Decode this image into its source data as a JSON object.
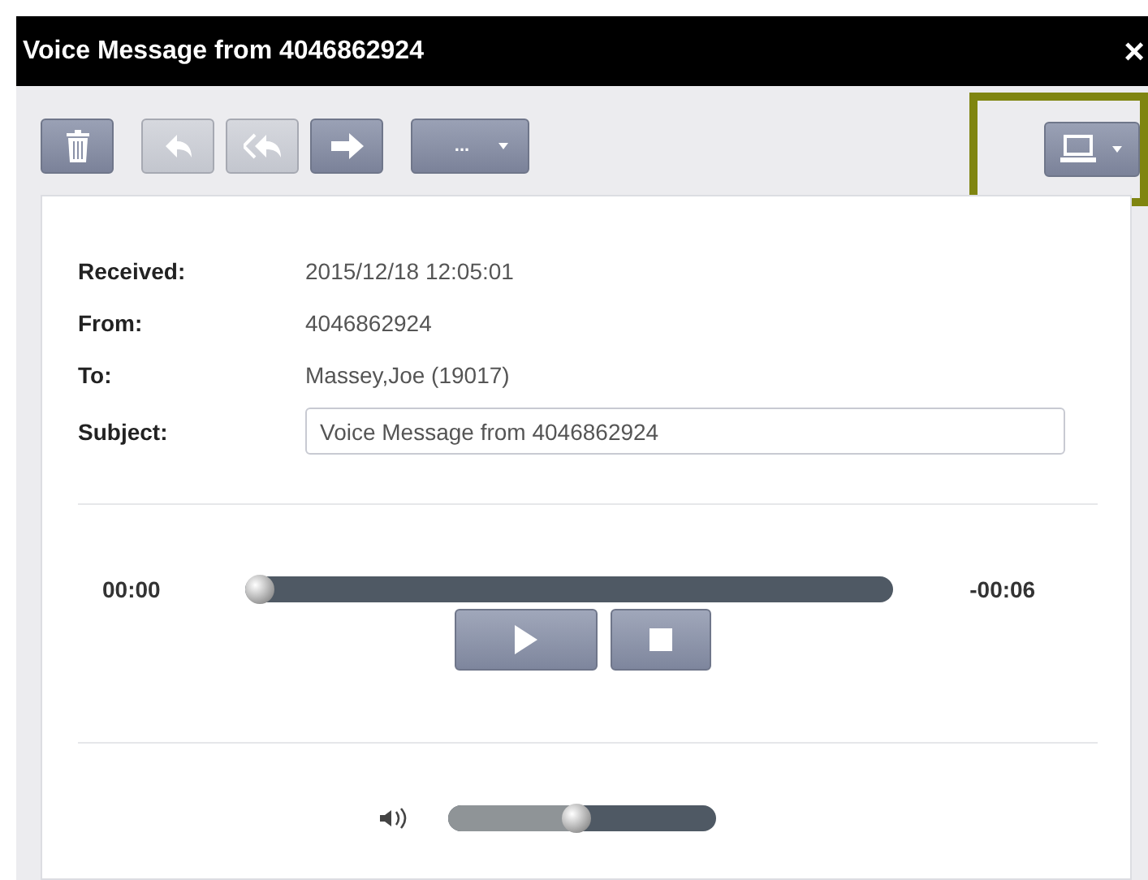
{
  "window": {
    "title": "Voice Message from 4046862924",
    "close": "×"
  },
  "toolbar": {
    "buttons": [
      {
        "kind": "delete",
        "disabled": false
      },
      {
        "kind": "reply",
        "disabled": true
      },
      {
        "kind": "reply-all",
        "disabled": true
      },
      {
        "kind": "forward",
        "disabled": false
      },
      {
        "kind": "more",
        "label": "...",
        "disabled": false
      }
    ],
    "device_button": {
      "highlighted": true
    }
  },
  "fields": [
    {
      "label": "Received:",
      "value": "2015/12/18 12:05:01"
    },
    {
      "label": "From:",
      "value": "4046862924"
    },
    {
      "label": "To:",
      "value": "Massey,Joe (19017)"
    }
  ],
  "subject": {
    "label": "Subject:",
    "value": "Voice Message from 4046862924"
  },
  "player": {
    "elapsed": "00:00",
    "remaining": "-00:06",
    "level": 0.0
  },
  "volume": {
    "level": 0.48
  }
}
